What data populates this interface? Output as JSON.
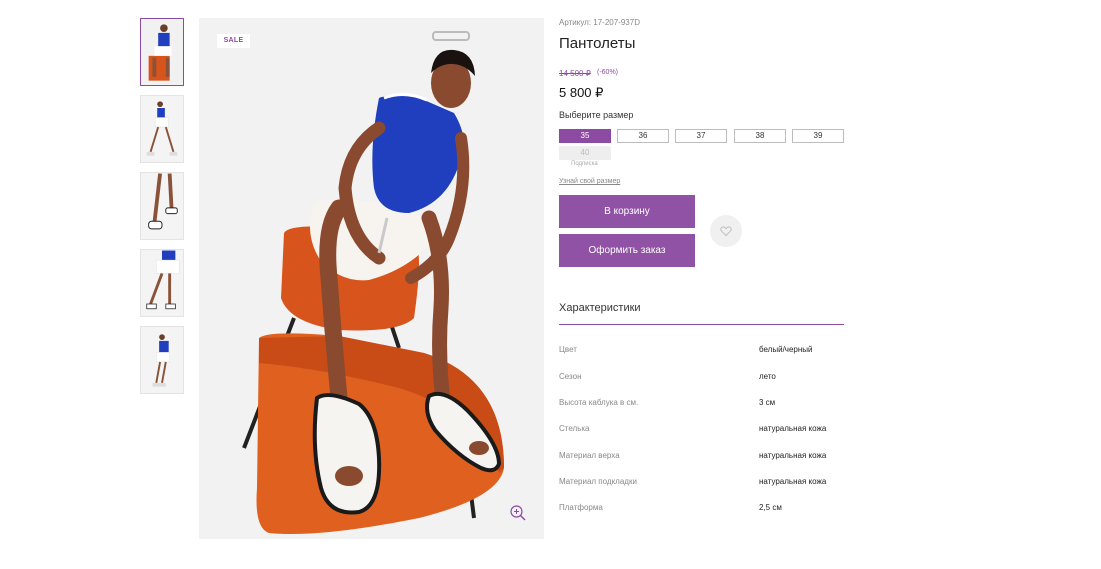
{
  "gallery": {
    "thumbnails": [
      {
        "alt": "thumb-1",
        "active": true
      },
      {
        "alt": "thumb-2",
        "active": false
      },
      {
        "alt": "thumb-3",
        "active": false
      },
      {
        "alt": "thumb-4",
        "active": false
      },
      {
        "alt": "thumb-5",
        "active": false
      }
    ],
    "badge": "SALE"
  },
  "product": {
    "article": "Артикул: 17-207-937D",
    "title": "Пантолеты",
    "old_price": "14 500 ₽",
    "discount": "(-60%)",
    "price": "5 800 ₽"
  },
  "sizes": {
    "label": "Выберите размер",
    "options": [
      {
        "value": "35",
        "state": "selected"
      },
      {
        "value": "36",
        "state": "available"
      },
      {
        "value": "37",
        "state": "available"
      },
      {
        "value": "38",
        "state": "available"
      },
      {
        "value": "39",
        "state": "available"
      },
      {
        "value": "40",
        "state": "disabled"
      }
    ],
    "subscribe_label": "Подписка",
    "help_link": "Узнай свой размер"
  },
  "actions": {
    "add_to_cart": "В корзину",
    "checkout": "Оформить заказ"
  },
  "characteristics": {
    "title": "Характеристики",
    "rows": [
      {
        "name": "Цвет",
        "value": "белый/черный"
      },
      {
        "name": "Сезон",
        "value": "лето"
      },
      {
        "name": "Высота каблука в см.",
        "value": "3 см"
      },
      {
        "name": "Стелька",
        "value": "натуральная кожа"
      },
      {
        "name": "Материал верха",
        "value": "натуральная кожа"
      },
      {
        "name": "Материал подкладки",
        "value": "натуральная кожа"
      },
      {
        "name": "Платформа",
        "value": "2,5 см"
      }
    ]
  },
  "colors": {
    "accent": "#8d4aa3",
    "chair": "#d7551d",
    "top": "#1f3fbf"
  }
}
